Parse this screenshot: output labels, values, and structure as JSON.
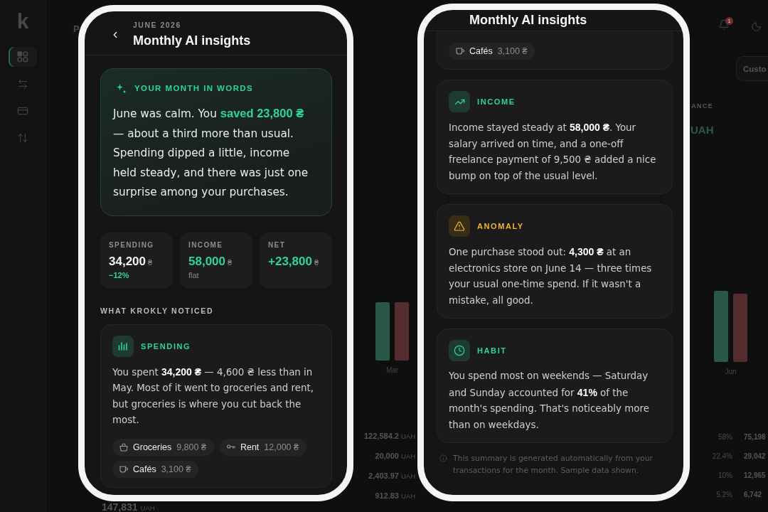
{
  "sidebar": {
    "logo": "k",
    "nav": [
      {
        "selected": true
      },
      {
        "selected": false
      },
      {
        "selected": false
      },
      {
        "selected": false
      }
    ]
  },
  "page_header": {
    "title": "P",
    "notification_badge": "1",
    "period_button": "Custo"
  },
  "balance": {
    "label": "ANCE",
    "value": "UAH"
  },
  "chart": {
    "groups": [
      {
        "label": "Mar"
      },
      {
        "label": "Jun"
      }
    ]
  },
  "breakdown_left": [
    {
      "amount": "122,584.2",
      "unit": "UAH"
    },
    {
      "amount": "20,000",
      "unit": "UAH"
    },
    {
      "amount": "2,403.97",
      "unit": "UAH"
    },
    {
      "amount": "912.83",
      "unit": "UAH"
    }
  ],
  "breakdown_right": [
    {
      "share": "58%",
      "amount": "75,198"
    },
    {
      "share": "22.4%",
      "amount": "29,042"
    },
    {
      "share": "10%",
      "amount": "12,965"
    },
    {
      "share": "5.2%",
      "amount": "6,742"
    }
  ],
  "total": {
    "amount": "147,831",
    "unit": "UAH"
  },
  "phones": [
    {
      "header": {
        "back_button": true,
        "eyebrow": "JUNE 2026",
        "title": "Monthly AI insights"
      },
      "hero": {
        "label": "YOUR MONTH IN WORDS",
        "text": "June was calm. You **saved 23,800 ₴** — about a third more than usual. Spending dipped a little, income held steady, and there was just one surprise among your purchases."
      },
      "stats": [
        {
          "label": "SPENDING",
          "value": "34,200",
          "currency": "₴",
          "positive": false,
          "note": "−12%",
          "note_positive": true
        },
        {
          "label": "INCOME",
          "value": "58,000",
          "currency": "₴",
          "positive": true,
          "note": "flat",
          "note_positive": false
        },
        {
          "label": "NET",
          "value": "+23,800",
          "currency": "₴",
          "positive": true
        }
      ],
      "section_label": "WHAT KROKLY NOTICED",
      "insights": [
        {
          "kind": "spending",
          "title": "SPENDING",
          "text": "You spent **34,200 ₴** — 4,600 ₴ less than in May. Most of it went to groceries and rent, but groceries is where you cut back the most.",
          "chips": [
            {
              "kind": "groceries",
              "label": "Groceries",
              "amount": "9,800 ₴"
            },
            {
              "kind": "rent",
              "label": "Rent",
              "amount": "12,000 ₴"
            },
            {
              "kind": "cafes",
              "label": "Cafés",
              "amount": "3,100 ₴"
            }
          ]
        }
      ]
    },
    {
      "header": {
        "title": "Monthly AI insights"
      },
      "insights": [
        {
          "chips": [
            {
              "kind": "cafes",
              "label": "Cafés",
              "amount": "3,100 ₴"
            }
          ]
        },
        {
          "kind": "income",
          "title": "INCOME",
          "text": "Income stayed steady at **58,000 ₴**. Your salary arrived on time, and a one-off freelance payment of 9,500 ₴ added a nice bump on top of the usual level."
        },
        {
          "kind": "anomaly",
          "title": "ANOMALY",
          "text": "One purchase stood out: **4,300 ₴** at an electronics store on June 14 — three times your usual one-time spend. If it wasn't a mistake, all good."
        },
        {
          "kind": "habit",
          "title": "HABIT",
          "text": "You spend most on weekends — Saturday and Sunday accounted for **41%** of the month's spending. That's noticeably more than on weekdays."
        }
      ],
      "footnote": "This summary is generated automatically from your transactions for the month. Sample data shown."
    }
  ]
}
